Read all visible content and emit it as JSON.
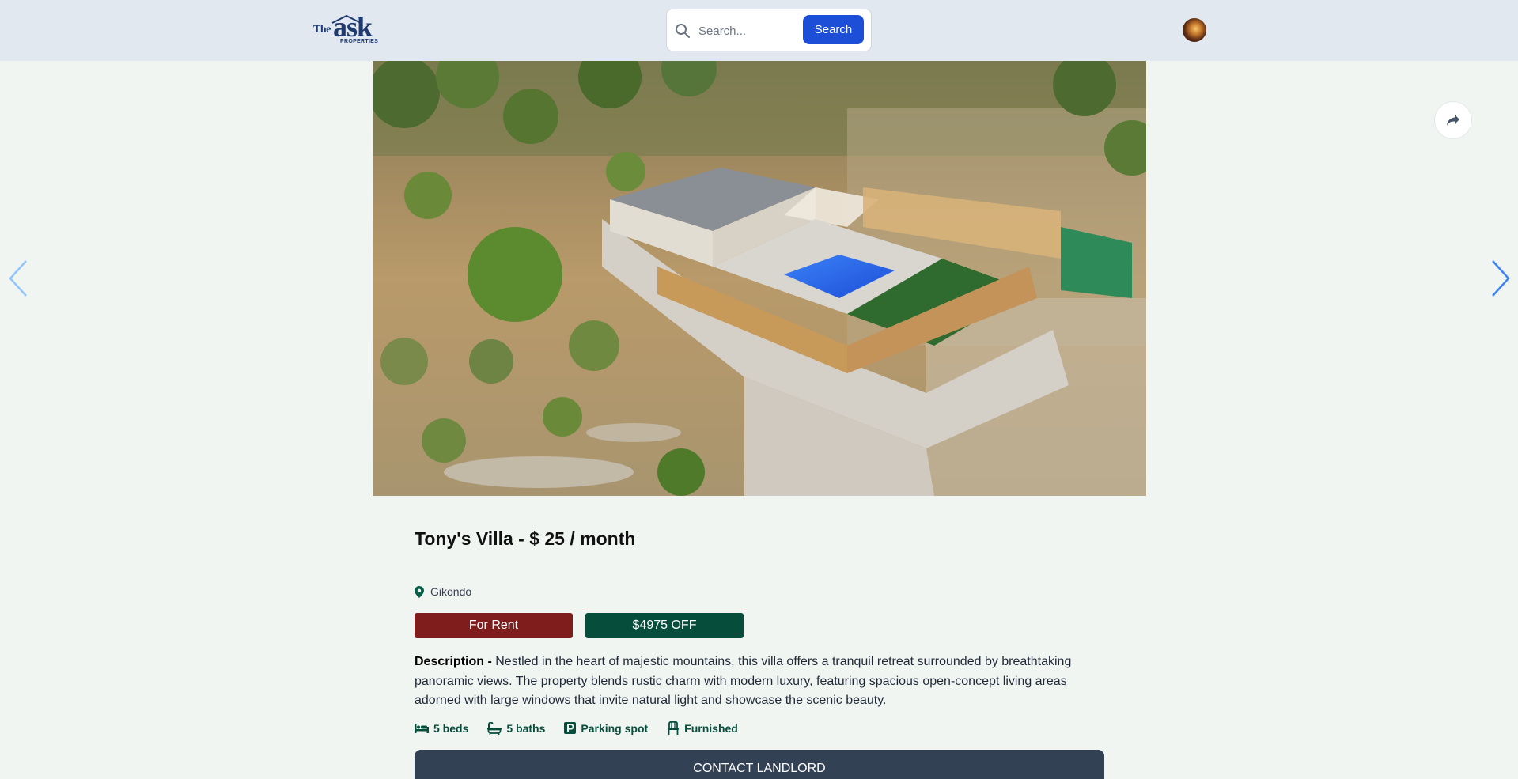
{
  "header": {
    "logo": {
      "the": "The",
      "ask": "ask",
      "sub": "PROPERTIES"
    },
    "search": {
      "placeholder": "Search...",
      "button_label": "Search"
    }
  },
  "listing": {
    "title": "Tony's Villa - $ 25 / month",
    "location": "Gikondo",
    "status_badge": "For Rent",
    "discount_badge": "$4975 OFF",
    "description_label": "Description -",
    "description": "Nestled in the heart of majestic mountains, this villa offers a tranquil retreat surrounded by breathtaking panoramic views. The property blends rustic charm with modern luxury, featuring spacious open-concept living areas adorned with large windows that invite natural light and showcase the scenic beauty.",
    "features": [
      {
        "icon": "bed-icon",
        "label": "5 beds"
      },
      {
        "icon": "bath-icon",
        "label": "5 baths"
      },
      {
        "icon": "parking-icon",
        "label": "Parking spot"
      },
      {
        "icon": "chair-icon",
        "label": "Furnished"
      }
    ],
    "contact_label": "CONTACT LANDLORD"
  },
  "colors": {
    "header_bg": "#e2e8f0",
    "page_bg": "#f1f5f2",
    "primary": "#1d4ed8",
    "rent_badge": "#7f1d1d",
    "discount_badge": "#064e3b",
    "feature_text": "#064e3b",
    "contact_button": "#334155"
  }
}
